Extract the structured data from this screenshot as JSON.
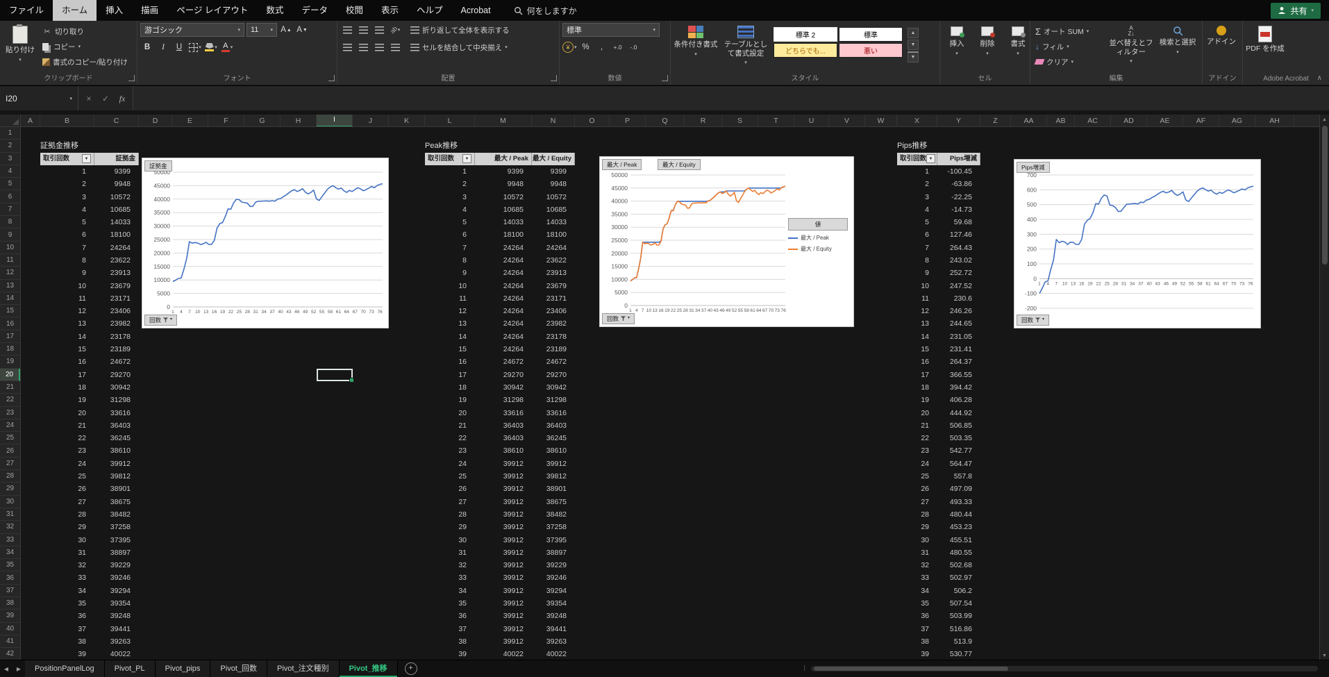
{
  "app": {
    "tabs": [
      "ファイル",
      "ホーム",
      "挿入",
      "描画",
      "ページ レイアウト",
      "数式",
      "データ",
      "校閲",
      "表示",
      "ヘルプ",
      "Acrobat"
    ],
    "active_tab": "ホーム",
    "search_placeholder": "何をしますか",
    "share_label": "共有"
  },
  "ribbon": {
    "clipboard": {
      "paste": "貼り付け",
      "cut": "切り取り",
      "copy": "コピー",
      "format_painter": "書式のコピー/貼り付け",
      "group": "クリップボード"
    },
    "font": {
      "name": "游ゴシック",
      "size": "11",
      "group": "フォント"
    },
    "alignment": {
      "wrap": "折り返して全体を表示する",
      "merge": "セルを結合して中央揃え",
      "group": "配置"
    },
    "number": {
      "format": "標準",
      "group": "数値"
    },
    "styles": {
      "conditional": "条件付き書式",
      "table_format": "テーブルとして書式設定",
      "gallery": [
        {
          "label": "標準 2",
          "bg": "#ffffff",
          "color": "#000000",
          "selected": true
        },
        {
          "label": "標準",
          "bg": "#ffffff",
          "color": "#000000",
          "selected": false
        },
        {
          "label": "どちらでも...",
          "bg": "#ffeb9c",
          "color": "#9c6500",
          "selected": false
        },
        {
          "label": "悪い",
          "bg": "#ffc7ce",
          "color": "#9c0006",
          "selected": false
        }
      ],
      "group": "スタイル"
    },
    "cells": {
      "insert": "挿入",
      "delete": "削除",
      "format": "書式",
      "group": "セル"
    },
    "editing": {
      "autosum": "オート SUM",
      "fill": "フィル",
      "clear": "クリア",
      "sort": "並べ替えとフィルター",
      "find": "検索と選択",
      "group": "編集"
    },
    "addins": {
      "addin": "アドイン",
      "group": "アドイン"
    },
    "acrobat": {
      "create_pdf": "PDF を作成",
      "group": "Adobe Acrobat"
    }
  },
  "formula_bar": {
    "name_box": "I20"
  },
  "grid": {
    "columns": [
      "A",
      "B",
      "C",
      "D",
      "E",
      "F",
      "G",
      "H",
      "I",
      "J",
      "K",
      "L",
      "M",
      "N",
      "O",
      "P",
      "Q",
      "R",
      "S",
      "T",
      "U",
      "V",
      "W",
      "X",
      "Y",
      "Z",
      "AA",
      "AB",
      "AC",
      "AD",
      "AE",
      "AF",
      "AG",
      "AH"
    ],
    "selected_cell": "I20",
    "selected_column": "I",
    "selected_row": 20,
    "row_count": 42
  },
  "tables": [
    {
      "title": "証拠金推移",
      "headers": [
        "取引回数",
        "証拠金"
      ],
      "rows": [
        [
          1,
          9399
        ],
        [
          2,
          9948
        ],
        [
          3,
          10572
        ],
        [
          4,
          10685
        ],
        [
          5,
          14033
        ],
        [
          6,
          18100
        ],
        [
          7,
          24264
        ],
        [
          8,
          23622
        ],
        [
          9,
          23913
        ],
        [
          10,
          23679
        ],
        [
          11,
          23171
        ],
        [
          12,
          23406
        ],
        [
          13,
          23982
        ],
        [
          14,
          23178
        ],
        [
          15,
          23189
        ],
        [
          16,
          24672
        ],
        [
          17,
          29270
        ],
        [
          18,
          30942
        ],
        [
          19,
          31298
        ],
        [
          20,
          33616
        ],
        [
          21,
          36403
        ],
        [
          22,
          36245
        ],
        [
          23,
          38610
        ],
        [
          24,
          39912
        ],
        [
          25,
          39812
        ],
        [
          26,
          38901
        ],
        [
          27,
          38675
        ],
        [
          28,
          38482
        ],
        [
          29,
          37258
        ],
        [
          30,
          37395
        ],
        [
          31,
          38897
        ],
        [
          32,
          39229
        ],
        [
          33,
          39246
        ],
        [
          34,
          39294
        ],
        [
          35,
          39354
        ],
        [
          36,
          39248
        ],
        [
          37,
          39441
        ],
        [
          38,
          39263
        ],
        [
          39,
          40022
        ]
      ]
    },
    {
      "title": "Peak推移",
      "headers": [
        "取引回数",
        "最大 / Peak",
        "最大 / Equity"
      ],
      "rows": [
        [
          1,
          9399,
          9399
        ],
        [
          2,
          9948,
          9948
        ],
        [
          3,
          10572,
          10572
        ],
        [
          4,
          10685,
          10685
        ],
        [
          5,
          14033,
          14033
        ],
        [
          6,
          18100,
          18100
        ],
        [
          7,
          24264,
          24264
        ],
        [
          8,
          24264,
          23622
        ],
        [
          9,
          24264,
          23913
        ],
        [
          10,
          24264,
          23679
        ],
        [
          11,
          24264,
          23171
        ],
        [
          12,
          24264,
          23406
        ],
        [
          13,
          24264,
          23982
        ],
        [
          14,
          24264,
          23178
        ],
        [
          15,
          24264,
          23189
        ],
        [
          16,
          24672,
          24672
        ],
        [
          17,
          29270,
          29270
        ],
        [
          18,
          30942,
          30942
        ],
        [
          19,
          31298,
          31298
        ],
        [
          20,
          33616,
          33616
        ],
        [
          21,
          36403,
          36403
        ],
        [
          22,
          36403,
          36245
        ],
        [
          23,
          38610,
          38610
        ],
        [
          24,
          39912,
          39912
        ],
        [
          25,
          39912,
          39812
        ],
        [
          26,
          39912,
          38901
        ],
        [
          27,
          39912,
          38675
        ],
        [
          28,
          39912,
          38482
        ],
        [
          29,
          39912,
          37258
        ],
        [
          30,
          39912,
          37395
        ],
        [
          31,
          39912,
          38897
        ],
        [
          32,
          39912,
          39229
        ],
        [
          33,
          39912,
          39246
        ],
        [
          34,
          39912,
          39294
        ],
        [
          35,
          39912,
          39354
        ],
        [
          36,
          39912,
          39248
        ],
        [
          37,
          39912,
          39441
        ],
        [
          38,
          39912,
          39263
        ],
        [
          39,
          40022,
          40022
        ]
      ]
    },
    {
      "title": "Pips推移",
      "headers": [
        "取引回数",
        "Pips増減"
      ],
      "rows": [
        [
          1,
          -100.45
        ],
        [
          2,
          -63.86
        ],
        [
          3,
          -22.25
        ],
        [
          4,
          -14.73
        ],
        [
          5,
          59.68
        ],
        [
          6,
          127.46
        ],
        [
          7,
          264.43
        ],
        [
          8,
          243.02
        ],
        [
          9,
          252.72
        ],
        [
          10,
          247.52
        ],
        [
          11,
          230.6
        ],
        [
          12,
          246.26
        ],
        [
          13,
          244.65
        ],
        [
          14,
          231.05
        ],
        [
          15,
          231.41
        ],
        [
          16,
          264.37
        ],
        [
          17,
          366.55
        ],
        [
          18,
          394.42
        ],
        [
          19,
          406.28
        ],
        [
          20,
          444.92
        ],
        [
          21,
          506.85
        ],
        [
          22,
          503.35
        ],
        [
          23,
          542.77
        ],
        [
          24,
          564.47
        ],
        [
          25,
          557.8
        ],
        [
          26,
          497.09
        ],
        [
          27,
          493.33
        ],
        [
          28,
          480.44
        ],
        [
          29,
          453.23
        ],
        [
          30,
          455.51
        ],
        [
          31,
          480.55
        ],
        [
          32,
          502.68
        ],
        [
          33,
          502.97
        ],
        [
          34,
          506.2
        ],
        [
          35,
          507.54
        ],
        [
          36,
          503.99
        ],
        [
          37,
          516.86
        ],
        [
          38,
          513.9
        ],
        [
          39,
          530.77
        ]
      ]
    }
  ],
  "chart_data": [
    {
      "type": "line",
      "value_button": "証拠金",
      "axis_button": "回数",
      "ylim": [
        0,
        50000
      ],
      "ytick_step": 5000,
      "x_ticks": [
        1,
        4,
        7,
        10,
        13,
        16,
        19,
        22,
        25,
        28,
        31,
        34,
        37,
        40,
        43,
        46,
        49,
        52,
        55,
        58,
        61,
        64,
        67,
        70,
        73,
        76
      ],
      "series": [
        {
          "name": "証拠金",
          "color": "#4472c4",
          "values": [
            9399,
            9948,
            10572,
            10685,
            14033,
            18100,
            24264,
            23622,
            23913,
            23679,
            23171,
            23406,
            23982,
            23178,
            23189,
            24672,
            29270,
            30942,
            31298,
            33616,
            36403,
            36245,
            38610,
            39912,
            39812,
            38901,
            38675,
            38482,
            37258,
            37395,
            38897,
            39229,
            39246,
            39294,
            39354,
            39248,
            39441,
            39263,
            40022,
            40213,
            40876,
            41544,
            42310,
            43065,
            43522,
            42870,
            43210,
            43890,
            42610,
            41930,
            42480,
            43370,
            40150,
            39480,
            40890,
            42260,
            43640,
            44520,
            45010,
            44280,
            43710,
            44120,
            43080,
            42490,
            43260,
            42850,
            43580,
            44240,
            43820,
            43110,
            43520,
            44060,
            44680,
            44230,
            45060,
            45480,
            45720
          ]
        }
      ]
    },
    {
      "type": "line",
      "buttons": [
        "最大 / Peak",
        "最大 / Equity"
      ],
      "legend_button": "値",
      "axis_button": "回数",
      "legend": true,
      "ylim": [
        0,
        50000
      ],
      "ytick_step": 5000,
      "x_ticks": [
        1,
        4,
        7,
        10,
        13,
        16,
        19,
        22,
        25,
        28,
        31,
        34,
        37,
        40,
        43,
        46,
        49,
        52,
        55,
        58,
        61,
        64,
        67,
        70,
        73,
        76
      ],
      "series": [
        {
          "name": "最大 / Peak",
          "color": "#4472c4",
          "values": [
            9399,
            9948,
            10572,
            10685,
            14033,
            18100,
            24264,
            24264,
            24264,
            24264,
            24264,
            24264,
            24264,
            24264,
            24264,
            24672,
            29270,
            30942,
            31298,
            33616,
            36403,
            36403,
            38610,
            39912,
            39912,
            39912,
            39912,
            39912,
            39912,
            39912,
            39912,
            39912,
            39912,
            39912,
            39912,
            39912,
            39912,
            39912,
            40022,
            40213,
            40876,
            41544,
            42310,
            43065,
            43522,
            43522,
            43522,
            43890,
            43890,
            43890,
            43890,
            43890,
            43890,
            43890,
            43890,
            43890,
            43890,
            44520,
            45010,
            45010,
            45010,
            45010,
            45010,
            45010,
            45010,
            45010,
            45010,
            45010,
            45010,
            45010,
            45010,
            45010,
            45010,
            45010,
            45060,
            45480,
            45720
          ]
        },
        {
          "name": "最大 / Equity",
          "color": "#ed7d31",
          "values": [
            9399,
            9948,
            10572,
            10685,
            14033,
            18100,
            24264,
            23622,
            23913,
            23679,
            23171,
            23406,
            23982,
            23178,
            23189,
            24672,
            29270,
            30942,
            31298,
            33616,
            36403,
            36245,
            38610,
            39912,
            39812,
            38901,
            38675,
            38482,
            37258,
            37395,
            38897,
            39229,
            39246,
            39294,
            39354,
            39248,
            39441,
            39263,
            40022,
            40213,
            40876,
            41544,
            42310,
            43065,
            43522,
            42870,
            43210,
            43890,
            42610,
            41930,
            42480,
            43370,
            40150,
            39480,
            40890,
            42260,
            43640,
            44520,
            45010,
            44280,
            43710,
            44120,
            43080,
            42490,
            43260,
            42850,
            43580,
            44240,
            43820,
            43110,
            43520,
            44060,
            44680,
            44230,
            45060,
            45480,
            45720
          ]
        }
      ]
    },
    {
      "type": "line",
      "value_button": "Pips増減",
      "axis_button": "回数",
      "ylim": [
        -200,
        700
      ],
      "ytick_step": 100,
      "x_ticks": [
        1,
        4,
        7,
        10,
        13,
        16,
        19,
        22,
        25,
        28,
        31,
        34,
        37,
        40,
        43,
        46,
        49,
        52,
        55,
        58,
        61,
        64,
        67,
        70,
        73,
        76
      ],
      "series": [
        {
          "name": "Pips増減",
          "color": "#4472c4",
          "values": [
            -100.45,
            -63.86,
            -22.25,
            -14.73,
            59.68,
            127.46,
            264.43,
            243.02,
            252.72,
            247.52,
            230.6,
            246.26,
            244.65,
            231.05,
            231.41,
            264.37,
            366.55,
            394.42,
            406.28,
            444.92,
            506.85,
            503.35,
            542.77,
            564.47,
            557.8,
            497.09,
            493.33,
            480.44,
            453.23,
            455.51,
            480.55,
            502.68,
            502.97,
            506.2,
            507.54,
            503.99,
            516.86,
            513.9,
            530.77,
            535,
            548,
            557,
            570,
            583,
            590,
            579,
            585,
            596,
            574,
            562,
            571,
            586,
            532,
            521,
            544,
            567,
            590,
            605,
            613,
            601,
            591,
            598,
            580,
            570,
            583,
            576,
            588,
            599,
            592,
            580,
            587,
            596,
            606,
            599,
            613,
            620,
            624
          ]
        }
      ]
    }
  ],
  "sheet_tabs": {
    "items": [
      "PositionPanelLog",
      "Pivot_PL",
      "Pivot_pips",
      "Pivot_回数",
      "Pivot_注文種別",
      "Pivot_推移"
    ],
    "active": "Pivot_推移",
    "add_label": "+"
  },
  "colors": {
    "accent_green": "#21a366",
    "chart_blue": "#4472c4",
    "chart_orange": "#ed7d31",
    "style_neutral_bg": "#ffeb9c",
    "style_neutral_text": "#9c6500",
    "style_bad_bg": "#ffc7ce",
    "style_bad_text": "#9c0006"
  }
}
